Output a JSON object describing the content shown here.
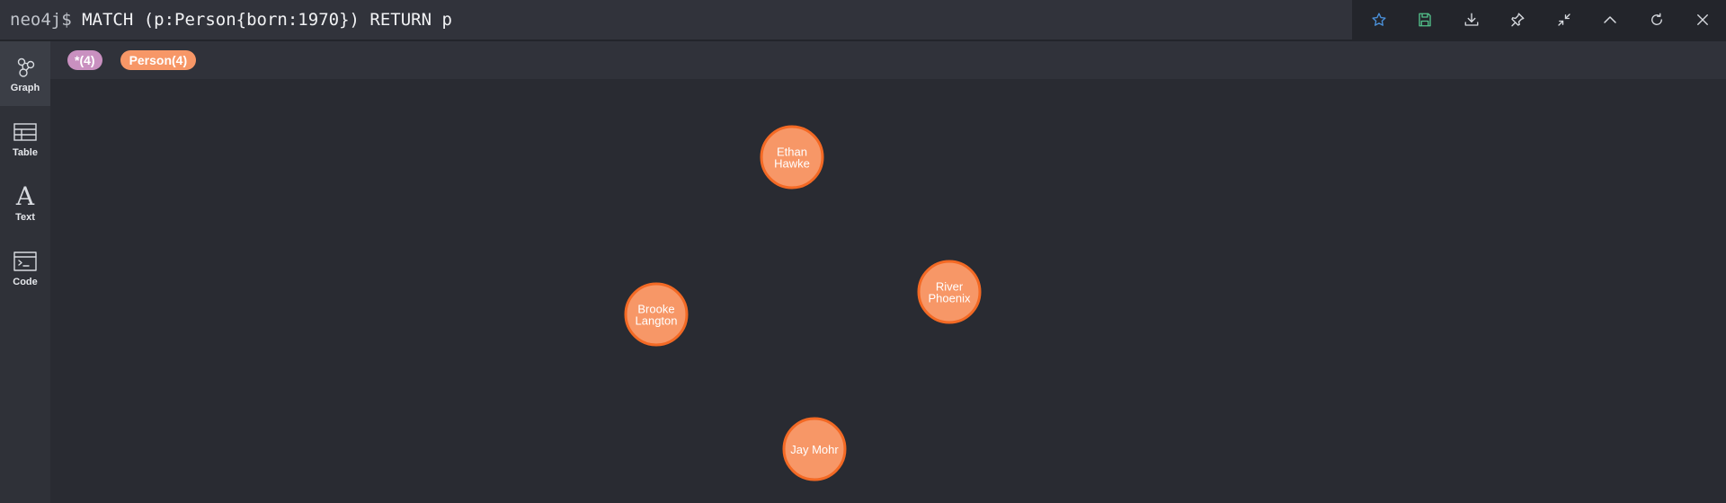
{
  "editor": {
    "prompt": "neo4j$",
    "query": "MATCH (p:Person{born:1970}) RETURN p"
  },
  "toolbar": {
    "actions": [
      {
        "name": "favorite-star-icon"
      },
      {
        "name": "save-icon"
      },
      {
        "name": "download-icon"
      },
      {
        "name": "pin-icon"
      },
      {
        "name": "collapse-icon"
      },
      {
        "name": "chevron-up-icon"
      },
      {
        "name": "refresh-icon"
      },
      {
        "name": "close-icon"
      }
    ]
  },
  "sidebar": {
    "items": [
      {
        "label": "Graph",
        "icon": "graph-icon",
        "active": true
      },
      {
        "label": "Table",
        "icon": "table-icon"
      },
      {
        "label": "Text",
        "icon": "text-icon"
      },
      {
        "label": "Code",
        "icon": "code-icon"
      }
    ]
  },
  "legend": {
    "all_label": "*(4)",
    "person_label": "Person(4)"
  },
  "colors": {
    "node_fill": "#f79767",
    "node_stroke": "#f36924",
    "all_pill": "#c990c0",
    "person_pill": "#f79767",
    "star_accent": "#4a90d9",
    "save_accent": "#53c28b"
  },
  "graph": {
    "nodes": [
      {
        "lines": [
          "Ethan",
          "Hawke"
        ]
      },
      {
        "lines": [
          "River",
          "Phoenix"
        ]
      },
      {
        "lines": [
          "Brooke",
          "Langton"
        ]
      },
      {
        "lines": [
          "Jay Mohr"
        ]
      }
    ]
  }
}
